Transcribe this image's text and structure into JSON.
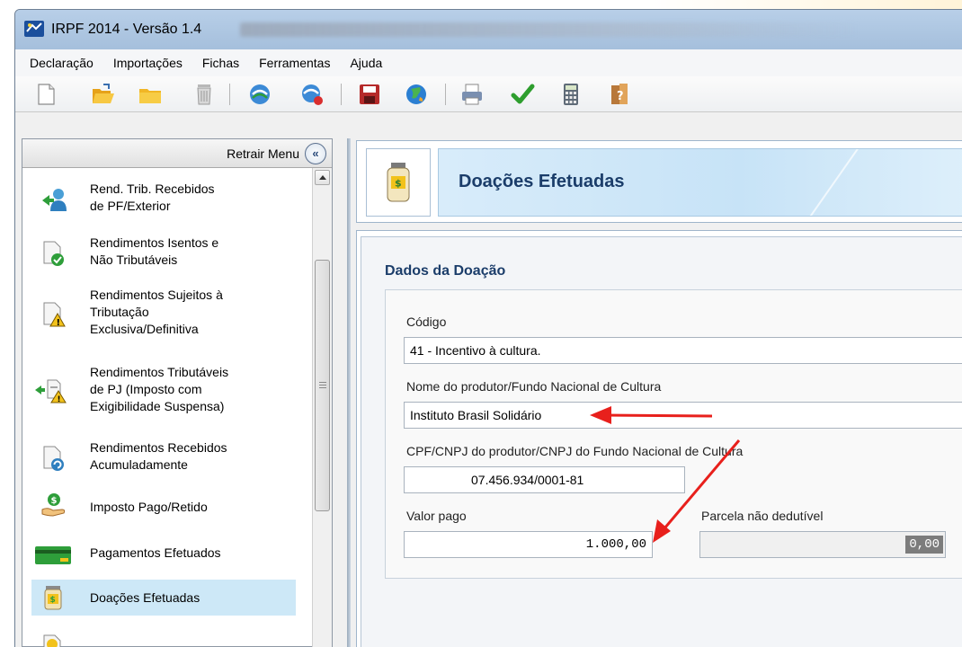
{
  "window": {
    "title": "IRPF 2014 - Versão 1.4"
  },
  "menubar": {
    "items": [
      {
        "label": "Declaração"
      },
      {
        "label": "Importações"
      },
      {
        "label": "Fichas"
      },
      {
        "label": "Ferramentas"
      },
      {
        "label": "Ajuda"
      }
    ]
  },
  "toolbar": {
    "buttons": [
      {
        "icon": "new-document-icon"
      },
      {
        "icon": "open-folder-icon"
      },
      {
        "icon": "folder-icon"
      },
      {
        "icon": "trash-icon"
      },
      {
        "icon": "transmit-globe-icon"
      },
      {
        "icon": "receive-globe-icon"
      },
      {
        "icon": "save-icon"
      },
      {
        "icon": "internet-globe-icon"
      },
      {
        "icon": "print-icon"
      },
      {
        "icon": "check-icon"
      },
      {
        "icon": "calculator-icon"
      },
      {
        "icon": "help-icon"
      }
    ]
  },
  "sidebar": {
    "retract_label": "Retrair Menu",
    "retract_glyph": "«",
    "items": [
      {
        "label": "Rend. Trib. Recebidos\nde PF/Exterior",
        "icon": "person-arrow-icon"
      },
      {
        "label": "Rendimentos Isentos e\nNão Tributáveis",
        "icon": "document-check-icon"
      },
      {
        "label": "Rendimentos Sujeitos à\nTributação\nExclusiva/Definitiva",
        "icon": "document-warning-icon"
      },
      {
        "label": "Rendimentos Tributáveis\nde PJ (Imposto com\nExigibilidade Suspensa)",
        "icon": "scale-warning-icon"
      },
      {
        "label": "Rendimentos Recebidos\nAcumuladamente",
        "icon": "document-refresh-icon"
      },
      {
        "label": "Imposto Pago/Retido",
        "icon": "hand-coin-icon"
      },
      {
        "label": "Pagamentos Efetuados",
        "icon": "credit-card-icon"
      },
      {
        "label": "Doações Efetuadas",
        "icon": "donation-jar-icon",
        "selected": true
      }
    ]
  },
  "header": {
    "title": "Doações Efetuadas",
    "icon": "donation-jar-icon"
  },
  "form": {
    "section_title": "Dados da Doação",
    "codigo_label": "Código",
    "codigo_value": "41 - Incentivo à cultura.",
    "nome_label": "Nome do produtor/Fundo Nacional de Cultura",
    "nome_value": "Instituto Brasil Solidário",
    "cpf_label": "CPF/CNPJ do produtor/CNPJ do Fundo Nacional de Cultura",
    "cpf_value": "07.456.934/0001-81",
    "valor_label": "Valor pago",
    "valor_value": "1.000,00",
    "parcela_label": "Parcela não dedutível",
    "parcela_value": "0,00"
  },
  "colors": {
    "arrow": "#e8201c",
    "header_title": "#1b3d6a",
    "selected_row": "#cde8f7"
  }
}
